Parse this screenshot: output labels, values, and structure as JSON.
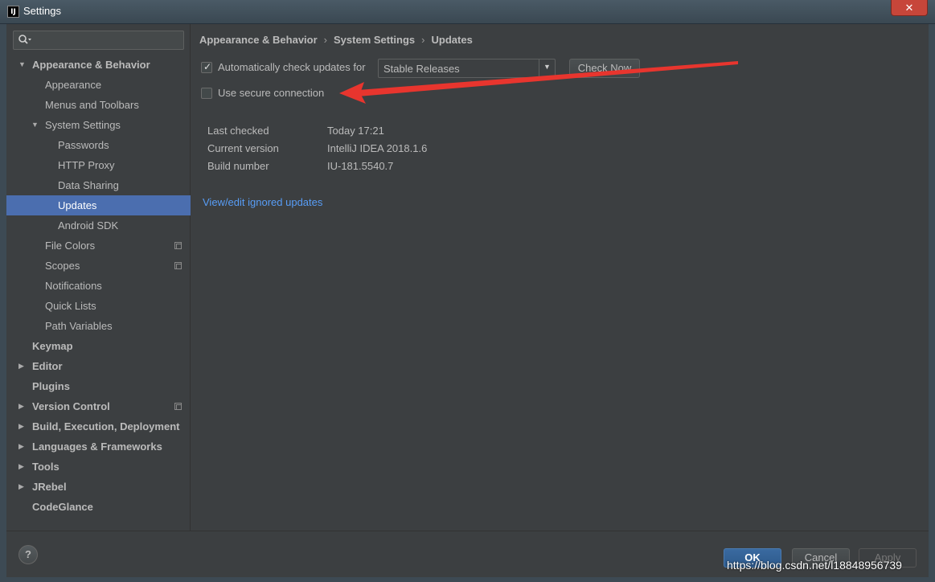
{
  "window": {
    "title": "Settings",
    "app_icon": "IJ",
    "close_label": "✕"
  },
  "search": {
    "placeholder": "",
    "value": ""
  },
  "sidebar": {
    "items": [
      {
        "label": "Appearance & Behavior",
        "level": 0,
        "bold": true,
        "arrow": "expanded"
      },
      {
        "label": "Appearance",
        "level": 1
      },
      {
        "label": "Menus and Toolbars",
        "level": 1
      },
      {
        "label": "System Settings",
        "level": 1,
        "arrow": "expanded"
      },
      {
        "label": "Passwords",
        "level": 2
      },
      {
        "label": "HTTP Proxy",
        "level": 2
      },
      {
        "label": "Data Sharing",
        "level": 2
      },
      {
        "label": "Updates",
        "level": 2,
        "selected": true
      },
      {
        "label": "Android SDK",
        "level": 2
      },
      {
        "label": "File Colors",
        "level": 1,
        "copy_icon": true
      },
      {
        "label": "Scopes",
        "level": 1,
        "copy_icon": true
      },
      {
        "label": "Notifications",
        "level": 1
      },
      {
        "label": "Quick Lists",
        "level": 1
      },
      {
        "label": "Path Variables",
        "level": 1
      },
      {
        "label": "Keymap",
        "level": 0,
        "bold": true
      },
      {
        "label": "Editor",
        "level": 0,
        "bold": true,
        "arrow": "collapsed"
      },
      {
        "label": "Plugins",
        "level": 0,
        "bold": true
      },
      {
        "label": "Version Control",
        "level": 0,
        "bold": true,
        "arrow": "collapsed",
        "copy_icon": true
      },
      {
        "label": "Build, Execution, Deployment",
        "level": 0,
        "bold": true,
        "arrow": "collapsed"
      },
      {
        "label": "Languages & Frameworks",
        "level": 0,
        "bold": true,
        "arrow": "collapsed"
      },
      {
        "label": "Tools",
        "level": 0,
        "bold": true,
        "arrow": "collapsed"
      },
      {
        "label": "JRebel",
        "level": 0,
        "bold": true,
        "arrow": "collapsed"
      },
      {
        "label": "CodeGlance",
        "level": 0,
        "bold": true
      }
    ]
  },
  "breadcrumb": {
    "part1": "Appearance & Behavior",
    "part2": "System Settings",
    "part3": "Updates",
    "separator": "›"
  },
  "updates": {
    "auto_check_label": "Automatically check updates for",
    "auto_check_checked": true,
    "channel": "Stable Releases",
    "check_now_label": "Check Now",
    "secure_label": "Use secure connection",
    "secure_checked": false,
    "info": [
      {
        "key": "Last checked",
        "value": "Today 17:21"
      },
      {
        "key": "Current version",
        "value": "IntelliJ IDEA 2018.1.6"
      },
      {
        "key": "Build number",
        "value": "IU-181.5540.7"
      }
    ],
    "ignored_link": "View/edit ignored updates"
  },
  "footer": {
    "help_label": "?",
    "ok_label": "OK",
    "cancel_label": "Cancel",
    "apply_label": "Apply"
  },
  "watermark": "https://blog.csdn.net/l18848956739",
  "colors": {
    "selection": "#4b6eaf",
    "link": "#589df6",
    "annotation_arrow": "#e8352e"
  }
}
